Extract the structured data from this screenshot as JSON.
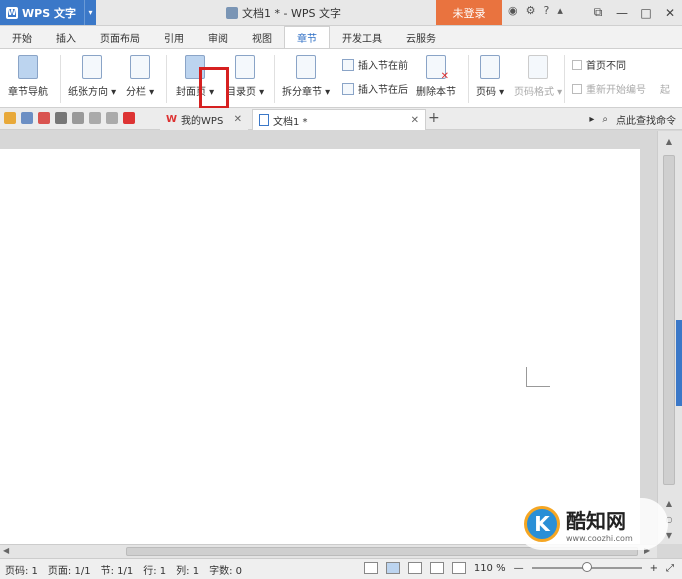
{
  "titlebar": {
    "app_name": "WPS 文字",
    "doc_title": "文档1 * - WPS 文字",
    "login_label": "未登录",
    "help": "?",
    "minimize": "—",
    "maximize": "□",
    "close": "✕"
  },
  "tabs": [
    {
      "label": "开始",
      "active": false
    },
    {
      "label": "插入",
      "active": false
    },
    {
      "label": "页面布局",
      "active": false
    },
    {
      "label": "引用",
      "active": false
    },
    {
      "label": "审阅",
      "active": false
    },
    {
      "label": "视图",
      "active": false
    },
    {
      "label": "章节",
      "active": true
    },
    {
      "label": "开发工具",
      "active": false
    },
    {
      "label": "云服务",
      "active": false
    }
  ],
  "ribbon": {
    "nav": "章节导航",
    "orientation": "纸张方向 ▾",
    "columns": "分栏 ▾",
    "cover": "封面页 ▾",
    "toc": "目录页 ▾",
    "split": "拆分章节 ▾",
    "insert_before": "插入节在前",
    "insert_after": "插入节在后",
    "delete_section": "删除本节",
    "page_number": "页码 ▾",
    "page_number_format": "页码格式 ▾",
    "first_page_diff": "首页不同",
    "restart_number": "重新开始编号",
    "start": "起"
  },
  "doc_tabs": {
    "mywps": "我的WPS",
    "doc1": "文档1 *",
    "add": "+",
    "search": "点此查找命令"
  },
  "statusbar": {
    "page_code": "页码: 1",
    "pages": "页面: 1/1",
    "section": "节: 1/1",
    "row": "行: 1",
    "col": "列: 1",
    "word_count": "字数: 0",
    "zoom": "110 %",
    "zoom_level": 0.5
  },
  "watermark": {
    "logo_letter": "K",
    "name": "酷知网",
    "url": "www.coozhi.com"
  },
  "colors": {
    "accent": "#3b78c8",
    "login": "#e9733f",
    "highlight": "#d62020"
  }
}
